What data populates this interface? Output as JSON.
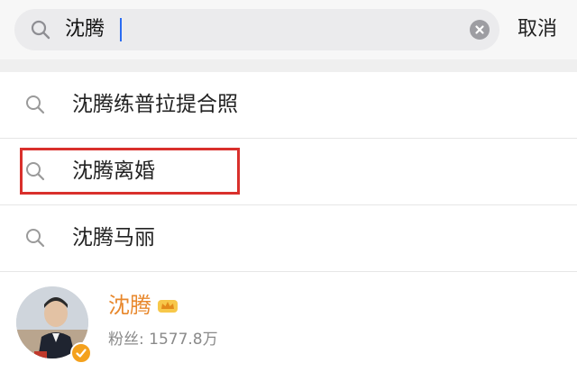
{
  "search": {
    "query": "沈腾",
    "cancel_label": "取消"
  },
  "suggestions": [
    {
      "text": "沈腾练普拉提合照",
      "icon": "search-icon"
    },
    {
      "text": "沈腾离婚",
      "icon": "search-icon",
      "highlighted": true
    },
    {
      "text": "沈腾马丽",
      "icon": "search-icon"
    }
  ],
  "user": {
    "name": "沈腾",
    "fans": "粉丝: 1577.8万",
    "badge_icon": "crown-icon",
    "verified_icon": "verified-badge-icon"
  },
  "colors": {
    "accent_name": "#e8882d",
    "highlight_border": "#d9302c",
    "caret": "#2a6cf2",
    "verified": "#f4a11e"
  }
}
